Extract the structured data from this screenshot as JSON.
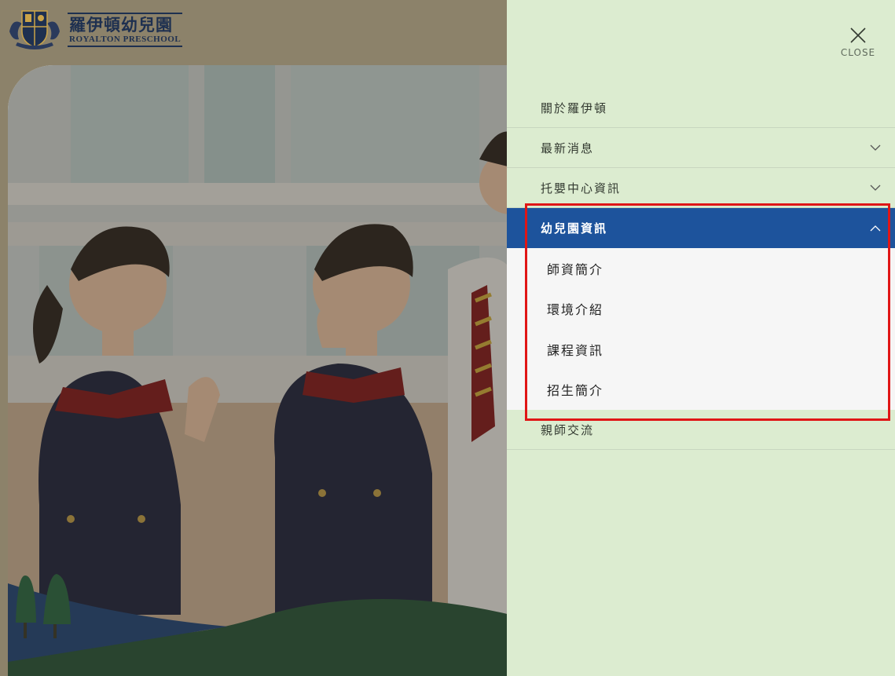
{
  "logo": {
    "name_cn": "羅伊頓幼兒園",
    "name_en": "ROYALTON PRESCHOOL"
  },
  "close": {
    "label": "CLOSE",
    "icon": "close-icon"
  },
  "menu": {
    "items": [
      {
        "label": "關於羅伊頓",
        "icon": null
      },
      {
        "label": "最新消息",
        "icon": "chevron-down-icon"
      },
      {
        "label": "托嬰中心資訊",
        "icon": "chevron-down-icon"
      },
      {
        "label": "幼兒園資訊",
        "icon": "chevron-up-icon",
        "expanded": true
      },
      {
        "label": "親師交流",
        "icon": null
      }
    ],
    "submenu": [
      {
        "label": "師資簡介"
      },
      {
        "label": "環境介紹"
      },
      {
        "label": "課程資訊"
      },
      {
        "label": "招生簡介"
      }
    ]
  },
  "colors": {
    "panel_bg": "#dcecd0",
    "active_bg": "#1d539c",
    "submenu_bg": "#f6f6f6",
    "highlight": "#e01616",
    "brand_navy": "#1e3050"
  }
}
